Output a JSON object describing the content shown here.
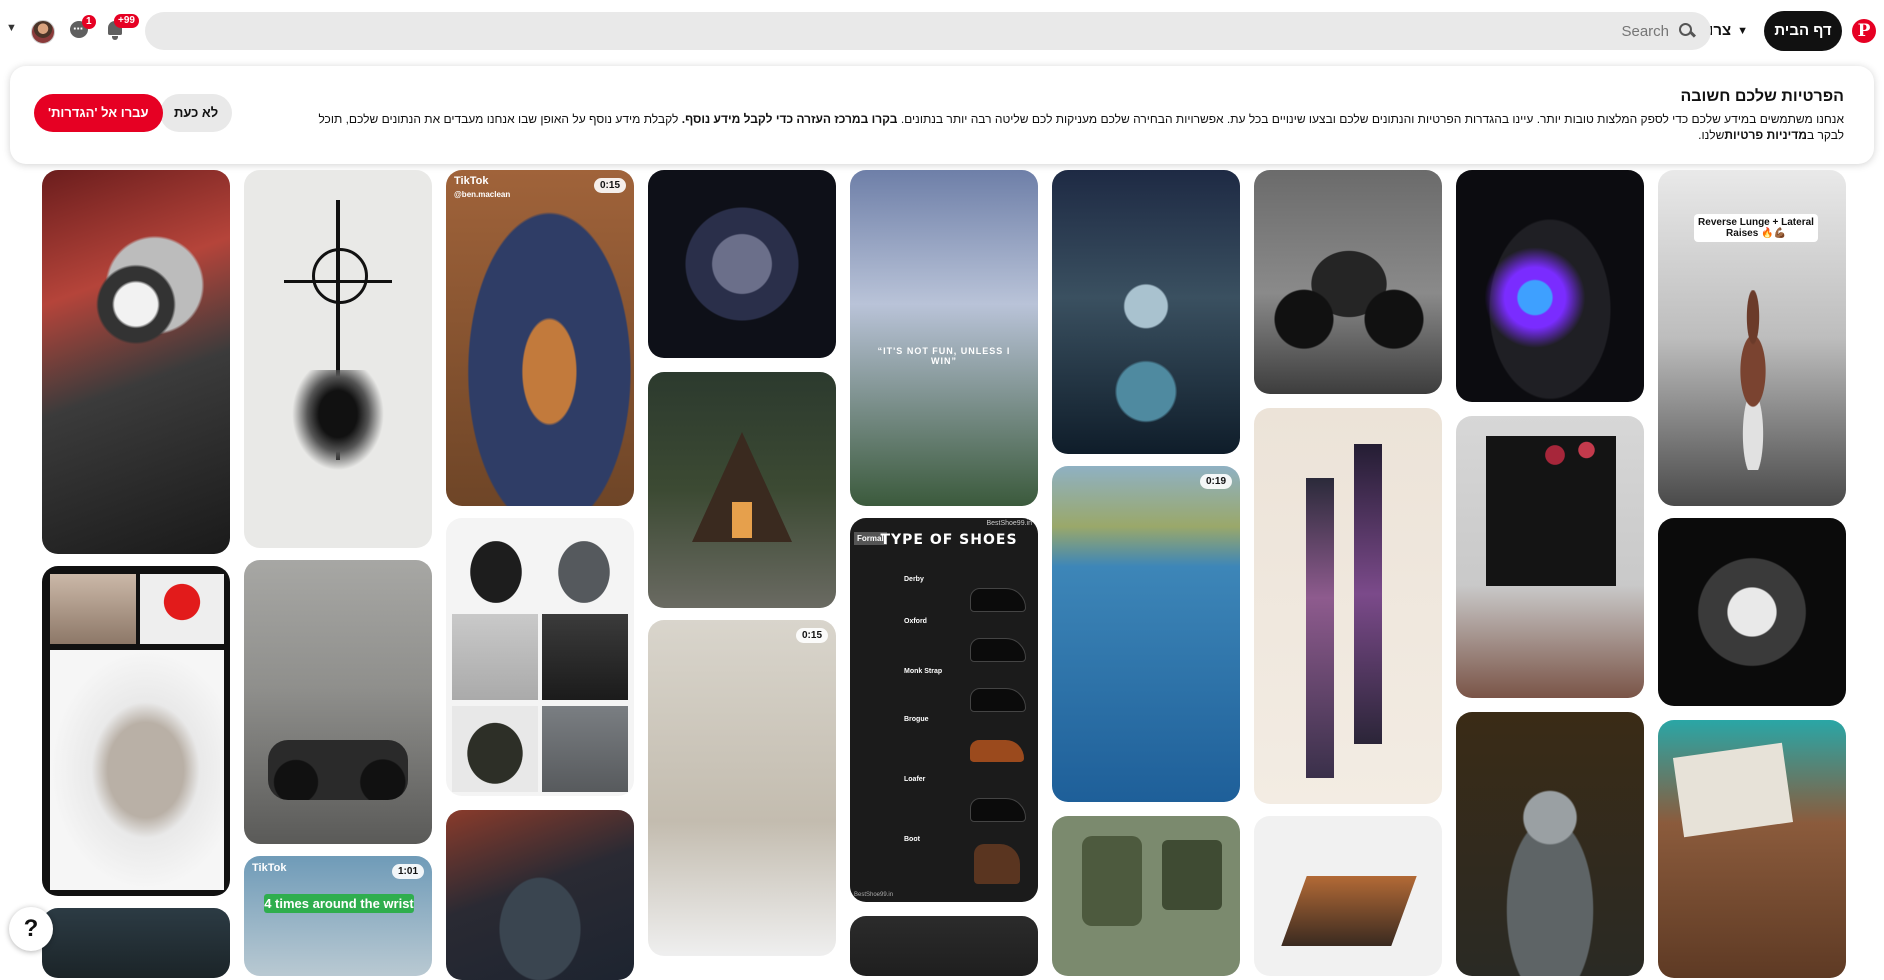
{
  "header": {
    "logo": "P",
    "home_label": "דף הבית",
    "create_label": "צרו",
    "search_placeholder": "Search",
    "notifications_count": "+99",
    "messages_count": "1"
  },
  "banner": {
    "title": "הפרטיות שלכם חשובה",
    "text_part1": "אנחנו משתמשים במידע שלכם כדי לספק המלצות טובות יותר. עיינו בהגדרות הפרטיות והנתונים שלכם ובצעו שינויים בכל עת. אפשרויות הבחירה שלכם מעניקות לכם שליטה רבה יותר בנתונים. ",
    "text_bold1": "בקרו במרכז העזרה כדי לקבל מידע נוסף.",
    "text_part2": " לקבלת מידע נוסף על האופן שבו אנחנו מעבדים את הנתונים שלכם, תוכל לבקר ב",
    "text_bold2": "מדיניות פרטיות",
    "text_part3": "שלנו.",
    "later_label": "לא כעת",
    "goto_label": "עברו אל 'הגדרות'"
  },
  "pins": {
    "p3_dur": "0:15",
    "p3_tiktok": "TikTok",
    "p3_handle": "@ben.maclean",
    "p5_quote": "“IT'S NOT FUN, UNLESS I WIN”",
    "p6_dur": "0:19",
    "p8_title": "Reverse Lunge + Lateral Raises 🔥💪🏾",
    "p11_dur": "0:15",
    "p12_title": "TYPE OF SHOES",
    "p12_tag": "Formal",
    "p12_brand": "BestShoe99.in",
    "p12_footer": "BestShoe99.in",
    "p12_items": [
      "Derby",
      "Oxford",
      "Monk Strap",
      "Brogue",
      "Loafer",
      "Boot"
    ],
    "p16_dur": "1:01",
    "p16_tiktok": "TikTok",
    "p16_caption": "4 times around the wrist"
  },
  "help_label": "?"
}
